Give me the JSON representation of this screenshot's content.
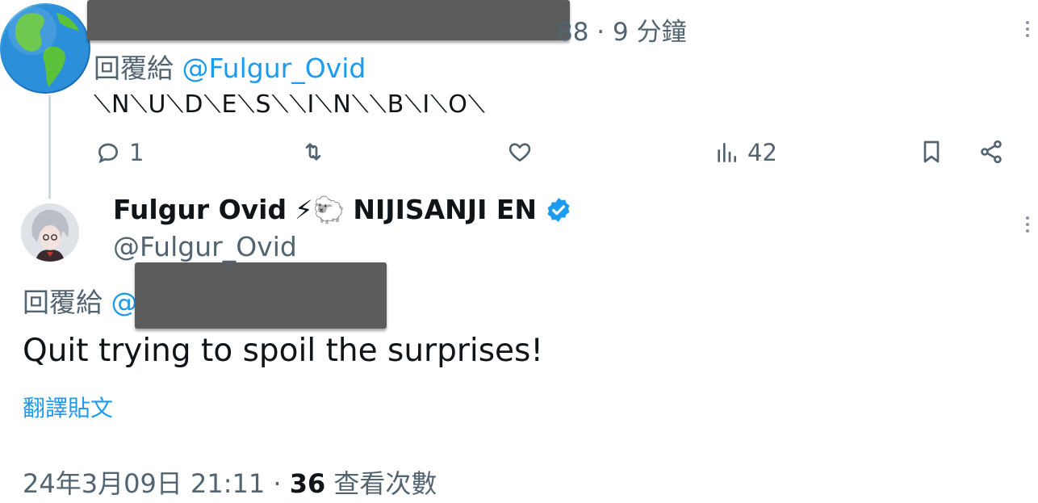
{
  "parent_tweet": {
    "meta": "88 · 9 分鐘",
    "reply_prefix": "回覆給",
    "reply_handle": "@Fulgur_Ovid",
    "text": "⟍N⟍U⟍D⟍E⟍S⟍⟍I⟍N⟍⟍B⟍I⟍O⟍",
    "actions": {
      "reply_count": "1",
      "retweet_count": "",
      "like_count": "",
      "view_count": "42"
    }
  },
  "main_tweet": {
    "display_name": "Fulgur Ovid",
    "name_emoji": "⚡🐑",
    "affiliation": "NIJISANJI EN",
    "handle": "@Fulgur_Ovid",
    "reply_prefix": "回覆給",
    "reply_handle_visible": "@",
    "text": "Quit trying to spoil the surprises!",
    "translate_label": "翻譯貼文",
    "timestamp": "24年3月09日 21:11",
    "separator": " · ",
    "view_count": "36",
    "view_label": "查看次數"
  },
  "colors": {
    "accent": "#1d9bf0",
    "text_primary": "#0f1419",
    "text_secondary": "#536471",
    "thread_line": "#cfd9de",
    "redaction": "#5c5c5c"
  },
  "icons": [
    "globe-icon",
    "reply-icon",
    "retweet-icon",
    "like-icon",
    "views-icon",
    "bookmark-icon",
    "share-icon",
    "verified-icon",
    "more-icon"
  ]
}
